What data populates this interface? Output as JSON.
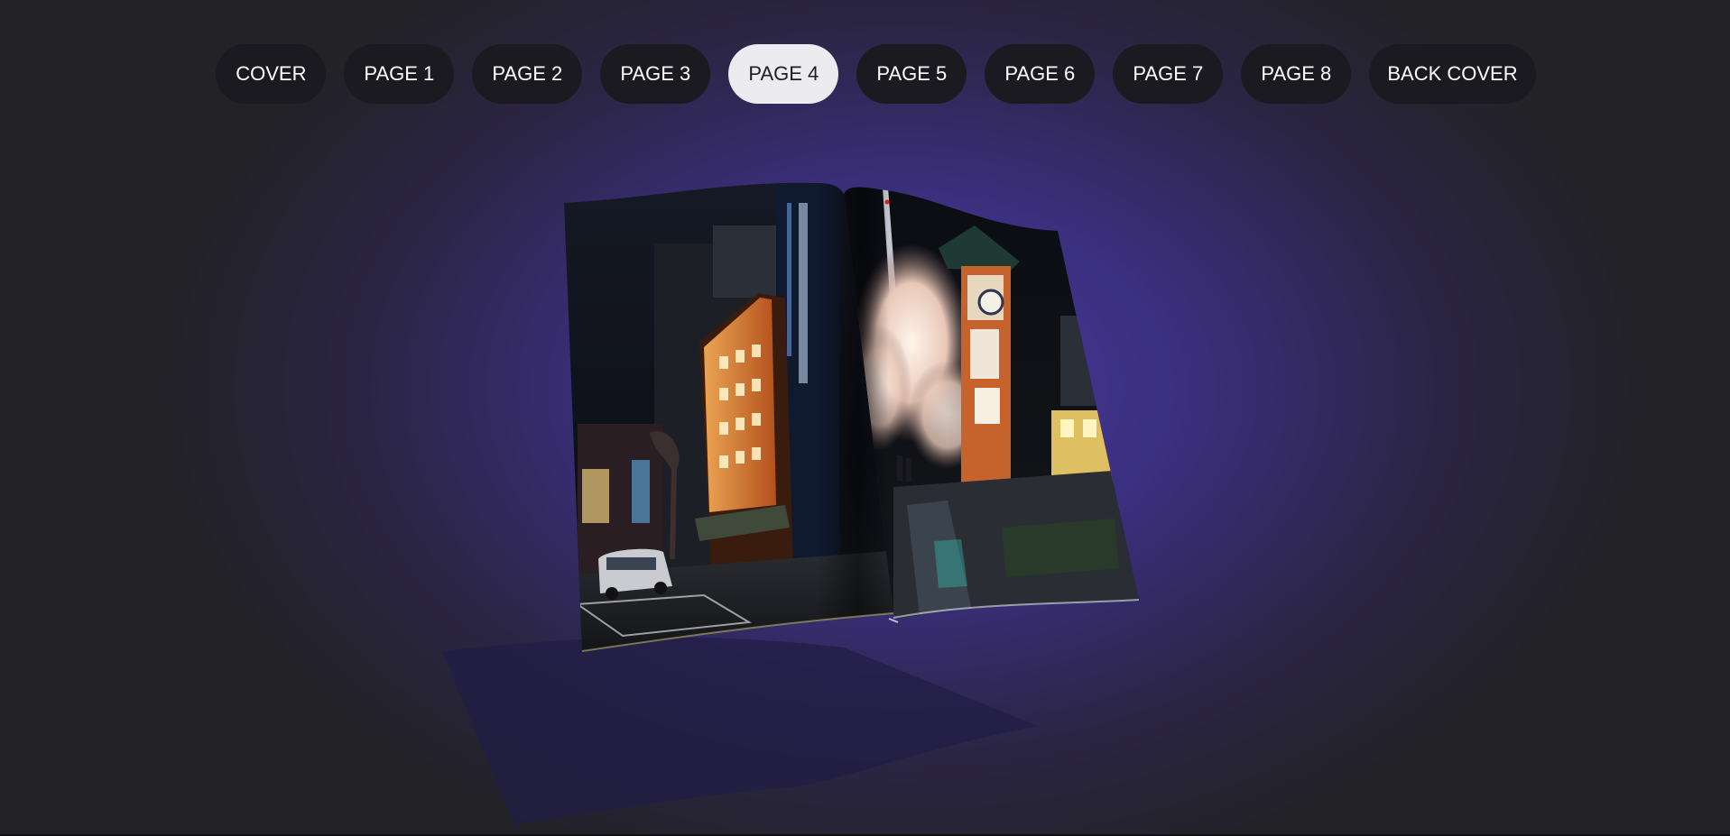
{
  "nav": {
    "pages": [
      "COVER",
      "PAGE 1",
      "PAGE 2",
      "PAGE 3",
      "PAGE 4",
      "PAGE 5",
      "PAGE 6",
      "PAGE 7",
      "PAGE 8",
      "BACK COVER"
    ],
    "active_index": 4
  },
  "book": {
    "left_page_image": "night-street-building-photo",
    "right_page_image": "clock-tower-cherry-blossom-photo"
  },
  "colors": {
    "accent_bg": "#4a3a9e",
    "button_bg": "#1b1a20",
    "button_active_bg": "#ececf0"
  }
}
